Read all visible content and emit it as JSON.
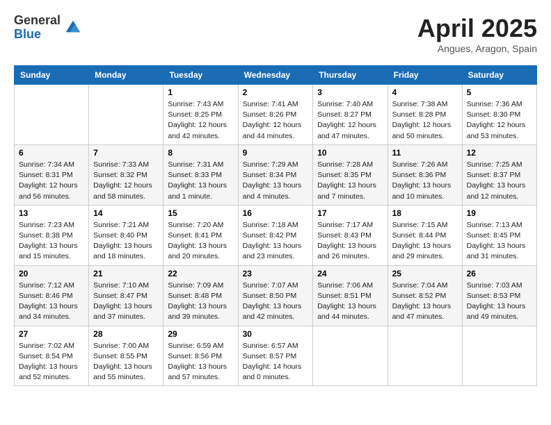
{
  "header": {
    "logo_general": "General",
    "logo_blue": "Blue",
    "title": "April 2025",
    "location": "Angues, Aragon, Spain"
  },
  "days_of_week": [
    "Sunday",
    "Monday",
    "Tuesday",
    "Wednesday",
    "Thursday",
    "Friday",
    "Saturday"
  ],
  "weeks": [
    [
      {
        "day": "",
        "info": ""
      },
      {
        "day": "",
        "info": ""
      },
      {
        "day": "1",
        "info": "Sunrise: 7:43 AM\nSunset: 8:25 PM\nDaylight: 12 hours and 42 minutes."
      },
      {
        "day": "2",
        "info": "Sunrise: 7:41 AM\nSunset: 8:26 PM\nDaylight: 12 hours and 44 minutes."
      },
      {
        "day": "3",
        "info": "Sunrise: 7:40 AM\nSunset: 8:27 PM\nDaylight: 12 hours and 47 minutes."
      },
      {
        "day": "4",
        "info": "Sunrise: 7:38 AM\nSunset: 8:28 PM\nDaylight: 12 hours and 50 minutes."
      },
      {
        "day": "5",
        "info": "Sunrise: 7:36 AM\nSunset: 8:30 PM\nDaylight: 12 hours and 53 minutes."
      }
    ],
    [
      {
        "day": "6",
        "info": "Sunrise: 7:34 AM\nSunset: 8:31 PM\nDaylight: 12 hours and 56 minutes."
      },
      {
        "day": "7",
        "info": "Sunrise: 7:33 AM\nSunset: 8:32 PM\nDaylight: 12 hours and 58 minutes."
      },
      {
        "day": "8",
        "info": "Sunrise: 7:31 AM\nSunset: 8:33 PM\nDaylight: 13 hours and 1 minute."
      },
      {
        "day": "9",
        "info": "Sunrise: 7:29 AM\nSunset: 8:34 PM\nDaylight: 13 hours and 4 minutes."
      },
      {
        "day": "10",
        "info": "Sunrise: 7:28 AM\nSunset: 8:35 PM\nDaylight: 13 hours and 7 minutes."
      },
      {
        "day": "11",
        "info": "Sunrise: 7:26 AM\nSunset: 8:36 PM\nDaylight: 13 hours and 10 minutes."
      },
      {
        "day": "12",
        "info": "Sunrise: 7:25 AM\nSunset: 8:37 PM\nDaylight: 13 hours and 12 minutes."
      }
    ],
    [
      {
        "day": "13",
        "info": "Sunrise: 7:23 AM\nSunset: 8:38 PM\nDaylight: 13 hours and 15 minutes."
      },
      {
        "day": "14",
        "info": "Sunrise: 7:21 AM\nSunset: 8:40 PM\nDaylight: 13 hours and 18 minutes."
      },
      {
        "day": "15",
        "info": "Sunrise: 7:20 AM\nSunset: 8:41 PM\nDaylight: 13 hours and 20 minutes."
      },
      {
        "day": "16",
        "info": "Sunrise: 7:18 AM\nSunset: 8:42 PM\nDaylight: 13 hours and 23 minutes."
      },
      {
        "day": "17",
        "info": "Sunrise: 7:17 AM\nSunset: 8:43 PM\nDaylight: 13 hours and 26 minutes."
      },
      {
        "day": "18",
        "info": "Sunrise: 7:15 AM\nSunset: 8:44 PM\nDaylight: 13 hours and 29 minutes."
      },
      {
        "day": "19",
        "info": "Sunrise: 7:13 AM\nSunset: 8:45 PM\nDaylight: 13 hours and 31 minutes."
      }
    ],
    [
      {
        "day": "20",
        "info": "Sunrise: 7:12 AM\nSunset: 8:46 PM\nDaylight: 13 hours and 34 minutes."
      },
      {
        "day": "21",
        "info": "Sunrise: 7:10 AM\nSunset: 8:47 PM\nDaylight: 13 hours and 37 minutes."
      },
      {
        "day": "22",
        "info": "Sunrise: 7:09 AM\nSunset: 8:48 PM\nDaylight: 13 hours and 39 minutes."
      },
      {
        "day": "23",
        "info": "Sunrise: 7:07 AM\nSunset: 8:50 PM\nDaylight: 13 hours and 42 minutes."
      },
      {
        "day": "24",
        "info": "Sunrise: 7:06 AM\nSunset: 8:51 PM\nDaylight: 13 hours and 44 minutes."
      },
      {
        "day": "25",
        "info": "Sunrise: 7:04 AM\nSunset: 8:52 PM\nDaylight: 13 hours and 47 minutes."
      },
      {
        "day": "26",
        "info": "Sunrise: 7:03 AM\nSunset: 8:53 PM\nDaylight: 13 hours and 49 minutes."
      }
    ],
    [
      {
        "day": "27",
        "info": "Sunrise: 7:02 AM\nSunset: 8:54 PM\nDaylight: 13 hours and 52 minutes."
      },
      {
        "day": "28",
        "info": "Sunrise: 7:00 AM\nSunset: 8:55 PM\nDaylight: 13 hours and 55 minutes."
      },
      {
        "day": "29",
        "info": "Sunrise: 6:59 AM\nSunset: 8:56 PM\nDaylight: 13 hours and 57 minutes."
      },
      {
        "day": "30",
        "info": "Sunrise: 6:57 AM\nSunset: 8:57 PM\nDaylight: 14 hours and 0 minutes."
      },
      {
        "day": "",
        "info": ""
      },
      {
        "day": "",
        "info": ""
      },
      {
        "day": "",
        "info": ""
      }
    ]
  ]
}
